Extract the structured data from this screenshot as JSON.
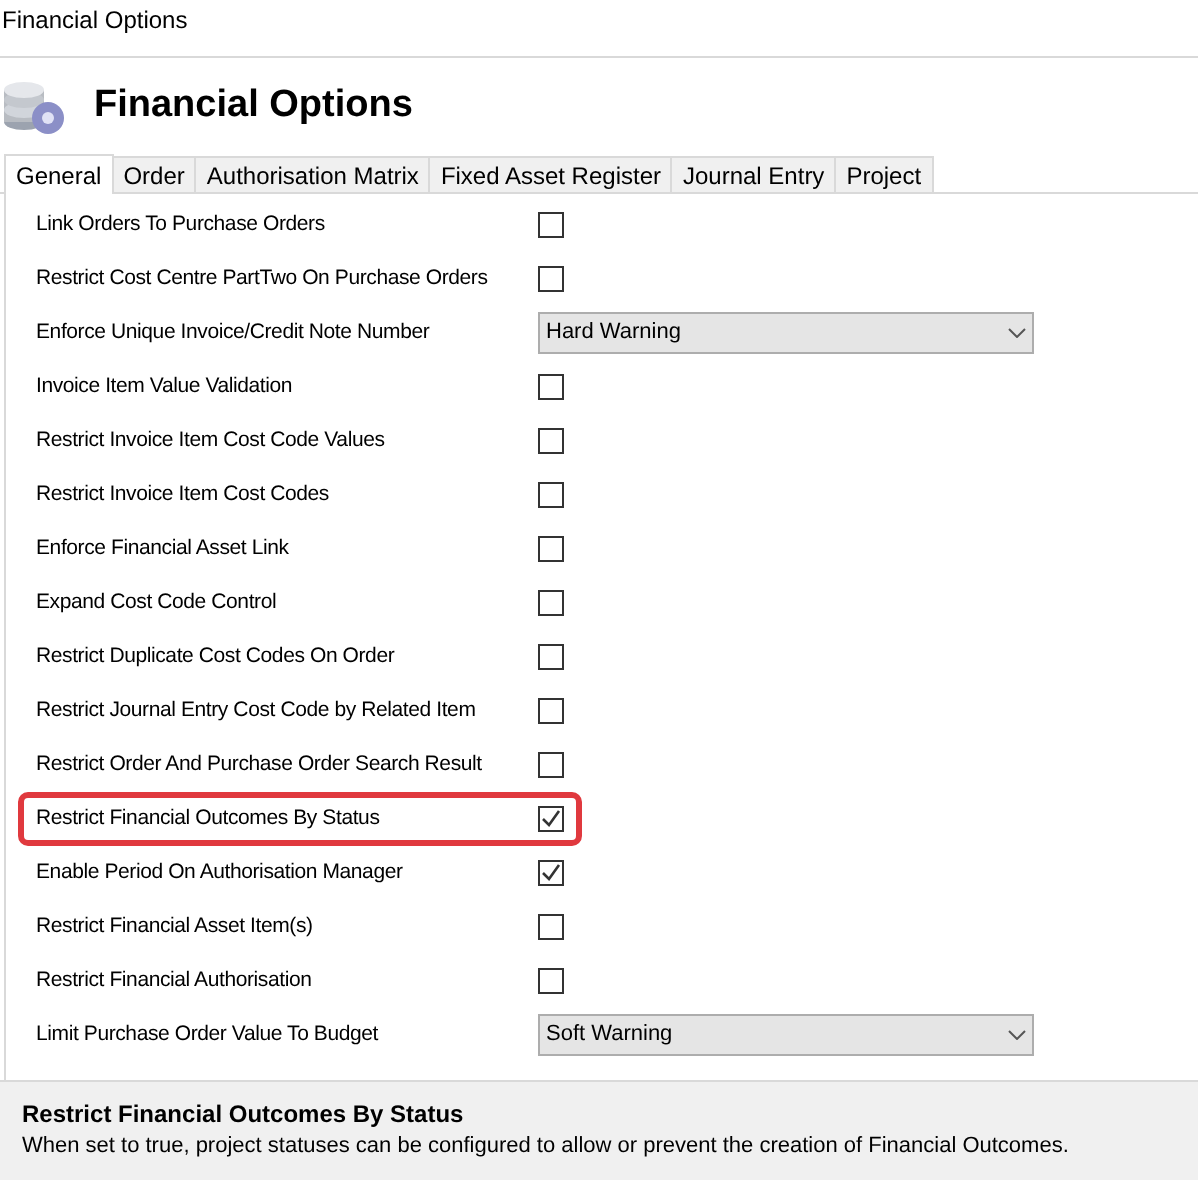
{
  "window": {
    "title": "Financial Options"
  },
  "header": {
    "title": "Financial Options"
  },
  "tabs": [
    {
      "label": "General",
      "selected": true
    },
    {
      "label": "Order",
      "selected": false
    },
    {
      "label": "Authorisation Matrix",
      "selected": false
    },
    {
      "label": "Fixed Asset Register",
      "selected": false
    },
    {
      "label": "Journal Entry",
      "selected": false
    },
    {
      "label": "Project",
      "selected": false
    }
  ],
  "settings": [
    {
      "label": "Link Orders To Purchase Orders",
      "kind": "checkbox",
      "checked": false
    },
    {
      "label": "Restrict Cost Centre PartTwo On Purchase Orders",
      "kind": "checkbox",
      "checked": false
    },
    {
      "label": "Enforce Unique Invoice/Credit Note Number",
      "kind": "dropdown",
      "value": "Hard Warning"
    },
    {
      "label": "Invoice Item Value Validation",
      "kind": "checkbox",
      "checked": false
    },
    {
      "label": "Restrict Invoice Item Cost Code Values",
      "kind": "checkbox",
      "checked": false
    },
    {
      "label": "Restrict Invoice Item Cost Codes",
      "kind": "checkbox",
      "checked": false
    },
    {
      "label": "Enforce Financial Asset Link",
      "kind": "checkbox",
      "checked": false
    },
    {
      "label": "Expand Cost Code Control",
      "kind": "checkbox",
      "checked": false
    },
    {
      "label": "Restrict Duplicate Cost Codes On Order",
      "kind": "checkbox",
      "checked": false
    },
    {
      "label": "Restrict Journal Entry Cost Code by Related Item",
      "kind": "checkbox",
      "checked": false
    },
    {
      "label": "Restrict Order And Purchase Order Search Result",
      "kind": "checkbox",
      "checked": false
    },
    {
      "label": "Restrict Financial Outcomes By Status",
      "kind": "checkbox",
      "checked": true,
      "highlighted": true
    },
    {
      "label": "Enable Period On Authorisation Manager",
      "kind": "checkbox",
      "checked": true
    },
    {
      "label": "Restrict Financial Asset Item(s)",
      "kind": "checkbox",
      "checked": false
    },
    {
      "label": "Restrict Financial Authorisation",
      "kind": "checkbox",
      "checked": false
    },
    {
      "label": "Limit Purchase Order Value To Budget",
      "kind": "dropdown",
      "value": "Soft Warning"
    }
  ],
  "description": {
    "title": "Restrict Financial Outcomes By Status",
    "text": "When set to true, project statuses can be configured to allow or prevent the creation of Financial Outcomes."
  }
}
